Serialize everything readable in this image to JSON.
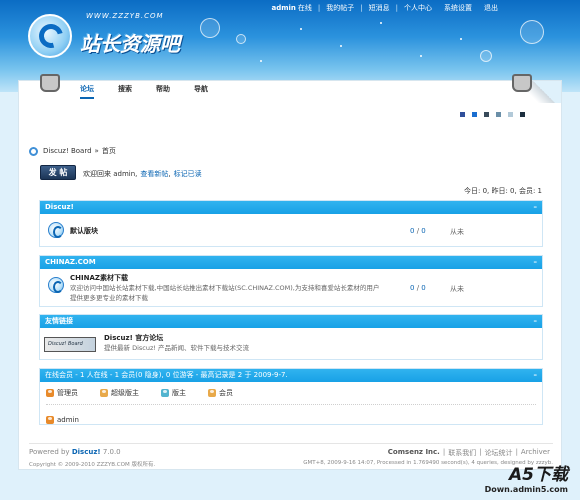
{
  "site": {
    "logo_url": "WWW.ZZZYB.COM",
    "logo_text": "站长资源吧"
  },
  "topnav": {
    "username": "admin",
    "online_label": "在线",
    "items": [
      "我的帖子",
      "短消息",
      "个人中心",
      "系统设置",
      "退出"
    ]
  },
  "mainnav": [
    "论坛",
    "搜索",
    "帮助",
    "导航"
  ],
  "theme_swatches": [
    "#2f4f9a",
    "#1a6ed0",
    "#384a5a",
    "#6b8fa8",
    "#b2c9d8",
    "#1c2e3e"
  ],
  "breadcrumb": {
    "board": "Discuz! Board",
    "sep": "»",
    "current": "首页"
  },
  "post_button": "发 帖",
  "welcome": {
    "text": "欢迎回来 admin,",
    "link1": "查看新帖",
    "link2": "标记已读"
  },
  "stats": "今日: 0, 昨日: 0, 会员: 1",
  "sections": [
    {
      "title": "Discuz!",
      "forums": [
        {
          "name": "默认版块",
          "desc": "",
          "threads": "0",
          "posts": "0",
          "last": "从未"
        }
      ]
    },
    {
      "title": "CHINAZ.COM",
      "forums": [
        {
          "name": "CHINAZ素材下载",
          "desc": "欢迎访问中国站长站素材下载,中国站长站推出素材下载站(SC.CHINAZ.COM),为支持和喜爱站长素材的用户提供更多更专业的素材下载",
          "threads": "0",
          "posts": "0",
          "last": "从未"
        }
      ]
    },
    {
      "title": "友情链接",
      "forums": [
        {
          "name": "Discuz! 官方论坛",
          "desc": "提供最新 Discuz! 产品新闻、软件下载与技术交流",
          "logo": "Discuz! Board"
        }
      ]
    }
  ],
  "online": {
    "header": "在线会员 - 1 人在线 - 1 会员(0 隐身), 0 位游客 - 最高记录是 2 于 2009-9-7.",
    "legend": [
      {
        "label": "管理员",
        "color": "#e88a2a"
      },
      {
        "label": "超级版主",
        "color": "#e8a94a"
      },
      {
        "label": "版主",
        "color": "#52b4cf"
      },
      {
        "label": "会员",
        "color": "#e8a94a"
      }
    ],
    "users": [
      "admin"
    ]
  },
  "footer": {
    "powered_prefix": "Powered by",
    "powered_name": "Discuz!",
    "version": "7.0.0",
    "copyright": "Copyright © 2009-2010 ZZZYB.COM 版权所有.",
    "links": [
      "Comsenz Inc.",
      "联系我们",
      "论坛统计",
      "Archiver"
    ],
    "gmt": "GMT+8, 2009-9-16 14:07, Processed in 1.769490 second(s), 4 queries, designed by zzzyb."
  },
  "watermark": {
    "big": "A5下载",
    "small": "Down.admin5.com"
  }
}
